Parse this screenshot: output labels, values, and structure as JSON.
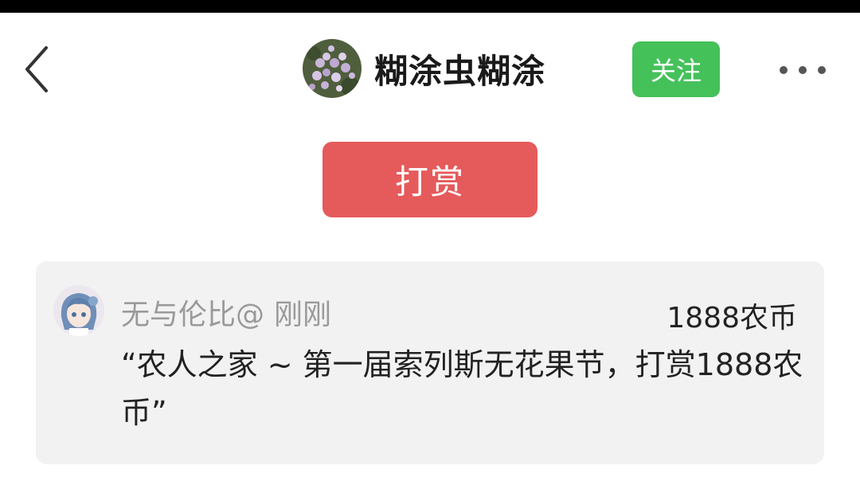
{
  "header": {
    "back_icon": "chevron-left-icon",
    "user_name": "糊涂虫糊涂",
    "follow_label": "关注",
    "more_icon": "more-dots-icon"
  },
  "colors": {
    "follow_bg": "#45c15a",
    "reward_bg": "#e55a5b",
    "card_bg": "#f2f2f2"
  },
  "reward_button": {
    "label": "打赏"
  },
  "reward_card": {
    "sender_name": "无与伦比@",
    "time": "刚刚",
    "amount": "1888农币",
    "message": "“农人之家 ~ 第一届索列斯无花果节，打赏1888农币”"
  }
}
